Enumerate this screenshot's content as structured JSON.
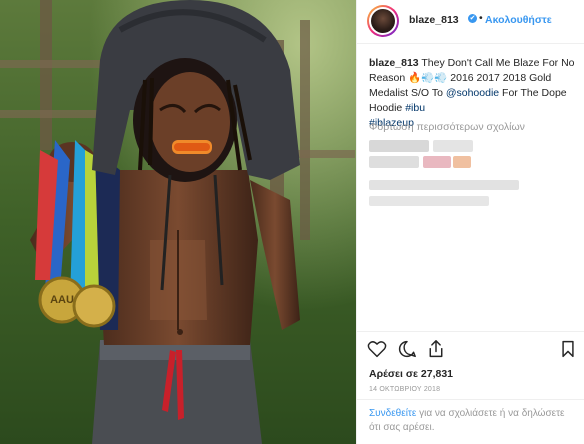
{
  "post": {
    "username": "blaze_813",
    "verified_mark": "✔",
    "separator": "•",
    "follow_label": "Ακολουθήστε",
    "caption": {
      "user": "blaze_813",
      "text1": " They Don't Call Me Blaze For No Reason ",
      "emojis": "🔥💨💨",
      "text2": " 2016 2017 2018 Gold Medalist S/O To ",
      "mention": "@sohoodie",
      "text3": " For The Dope Hoodie ",
      "tag1": "#ibu",
      "tag2": "#iblazeup"
    },
    "load_more_comments": "Φόρτωση περισσότερων σχολίων",
    "likes": "Αρέσει σε 27,831",
    "date": "14 ΟΚΤΩΒΡΙΟΥ 2018",
    "login_link": "Συνδεθείτε",
    "login_text": " για να σχολιάσετε ή να δηλώσετε ότι σας αρέσει."
  },
  "photo": {
    "medal_text": "AAU"
  },
  "icons": {
    "like": "heart-icon",
    "comment": "comment-icon",
    "share": "share-icon",
    "save": "bookmark-icon"
  },
  "colors": {
    "link_blue": "#3897f0",
    "mention_blue": "#003569",
    "muted": "#999999",
    "text": "#262626"
  }
}
